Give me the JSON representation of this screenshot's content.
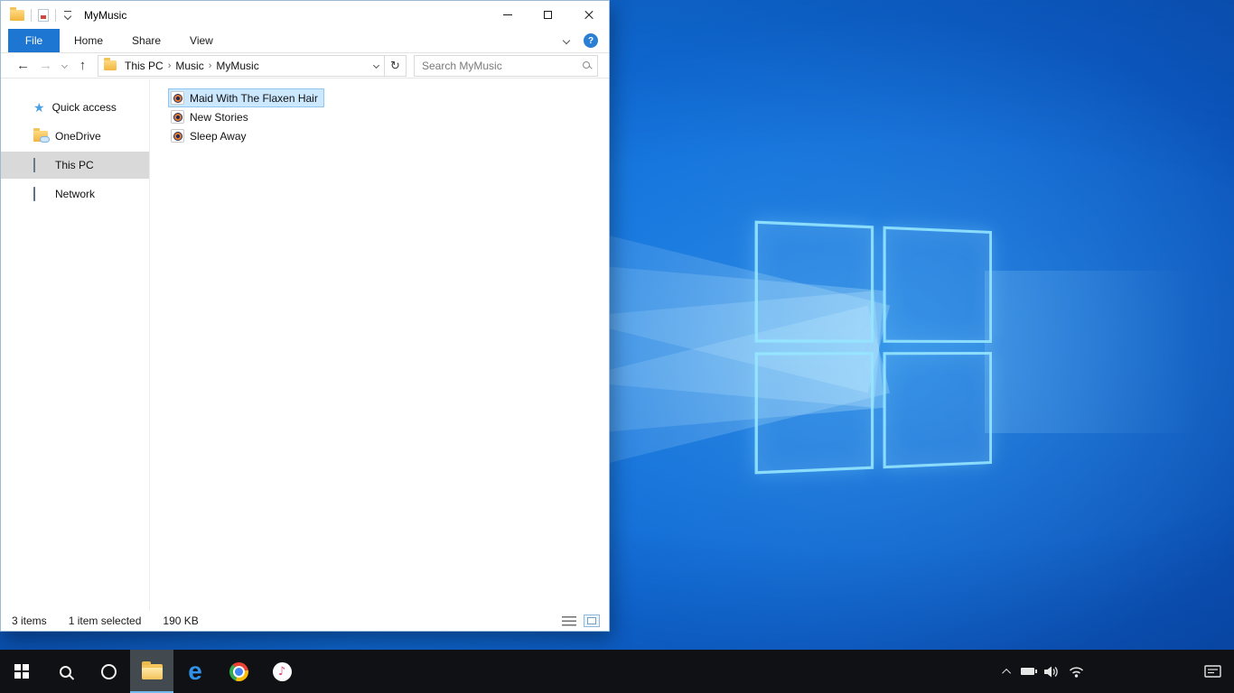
{
  "explorer": {
    "window_title": "MyMusic",
    "ribbon": {
      "tabs": [
        {
          "label": "File"
        },
        {
          "label": "Home"
        },
        {
          "label": "Share"
        },
        {
          "label": "View"
        }
      ],
      "help": "?"
    },
    "toolbar": {
      "icons": {
        "back": "←",
        "forward": "→",
        "up": "↑",
        "refresh": "↻"
      },
      "breadcrumb": [
        "This PC",
        "Music",
        "MyMusic"
      ],
      "crumb_separator": "›",
      "search_placeholder": "Search MyMusic",
      "search_value": ""
    },
    "sidebar": {
      "items": [
        {
          "label": "Quick access"
        },
        {
          "label": "OneDrive"
        },
        {
          "label": "This PC"
        },
        {
          "label": "Network"
        }
      ]
    },
    "files": [
      {
        "name": "Maid With The Flaxen Hair"
      },
      {
        "name": "New Stories"
      },
      {
        "name": "Sleep Away"
      }
    ],
    "status_bar": {
      "item_count": "3 items",
      "selection": "1 item selected",
      "size": "190 KB"
    }
  },
  "taskbar": {
    "app_icons": [
      "start",
      "search",
      "cortana",
      "file-explorer",
      "edge",
      "chrome",
      "itunes"
    ],
    "active_app": "file-explorer",
    "tray_icons": [
      "chevron-up",
      "battery",
      "volume",
      "wifi",
      "action-center"
    ]
  },
  "colors": {
    "accent": "#1d76d2",
    "selection_bg": "#cce8ff",
    "selection_border": "#8fc6f2",
    "sidebar_selected": "#d9d9d9",
    "taskbar_bg": "#101114",
    "wallpaper": "#0d63cf"
  }
}
